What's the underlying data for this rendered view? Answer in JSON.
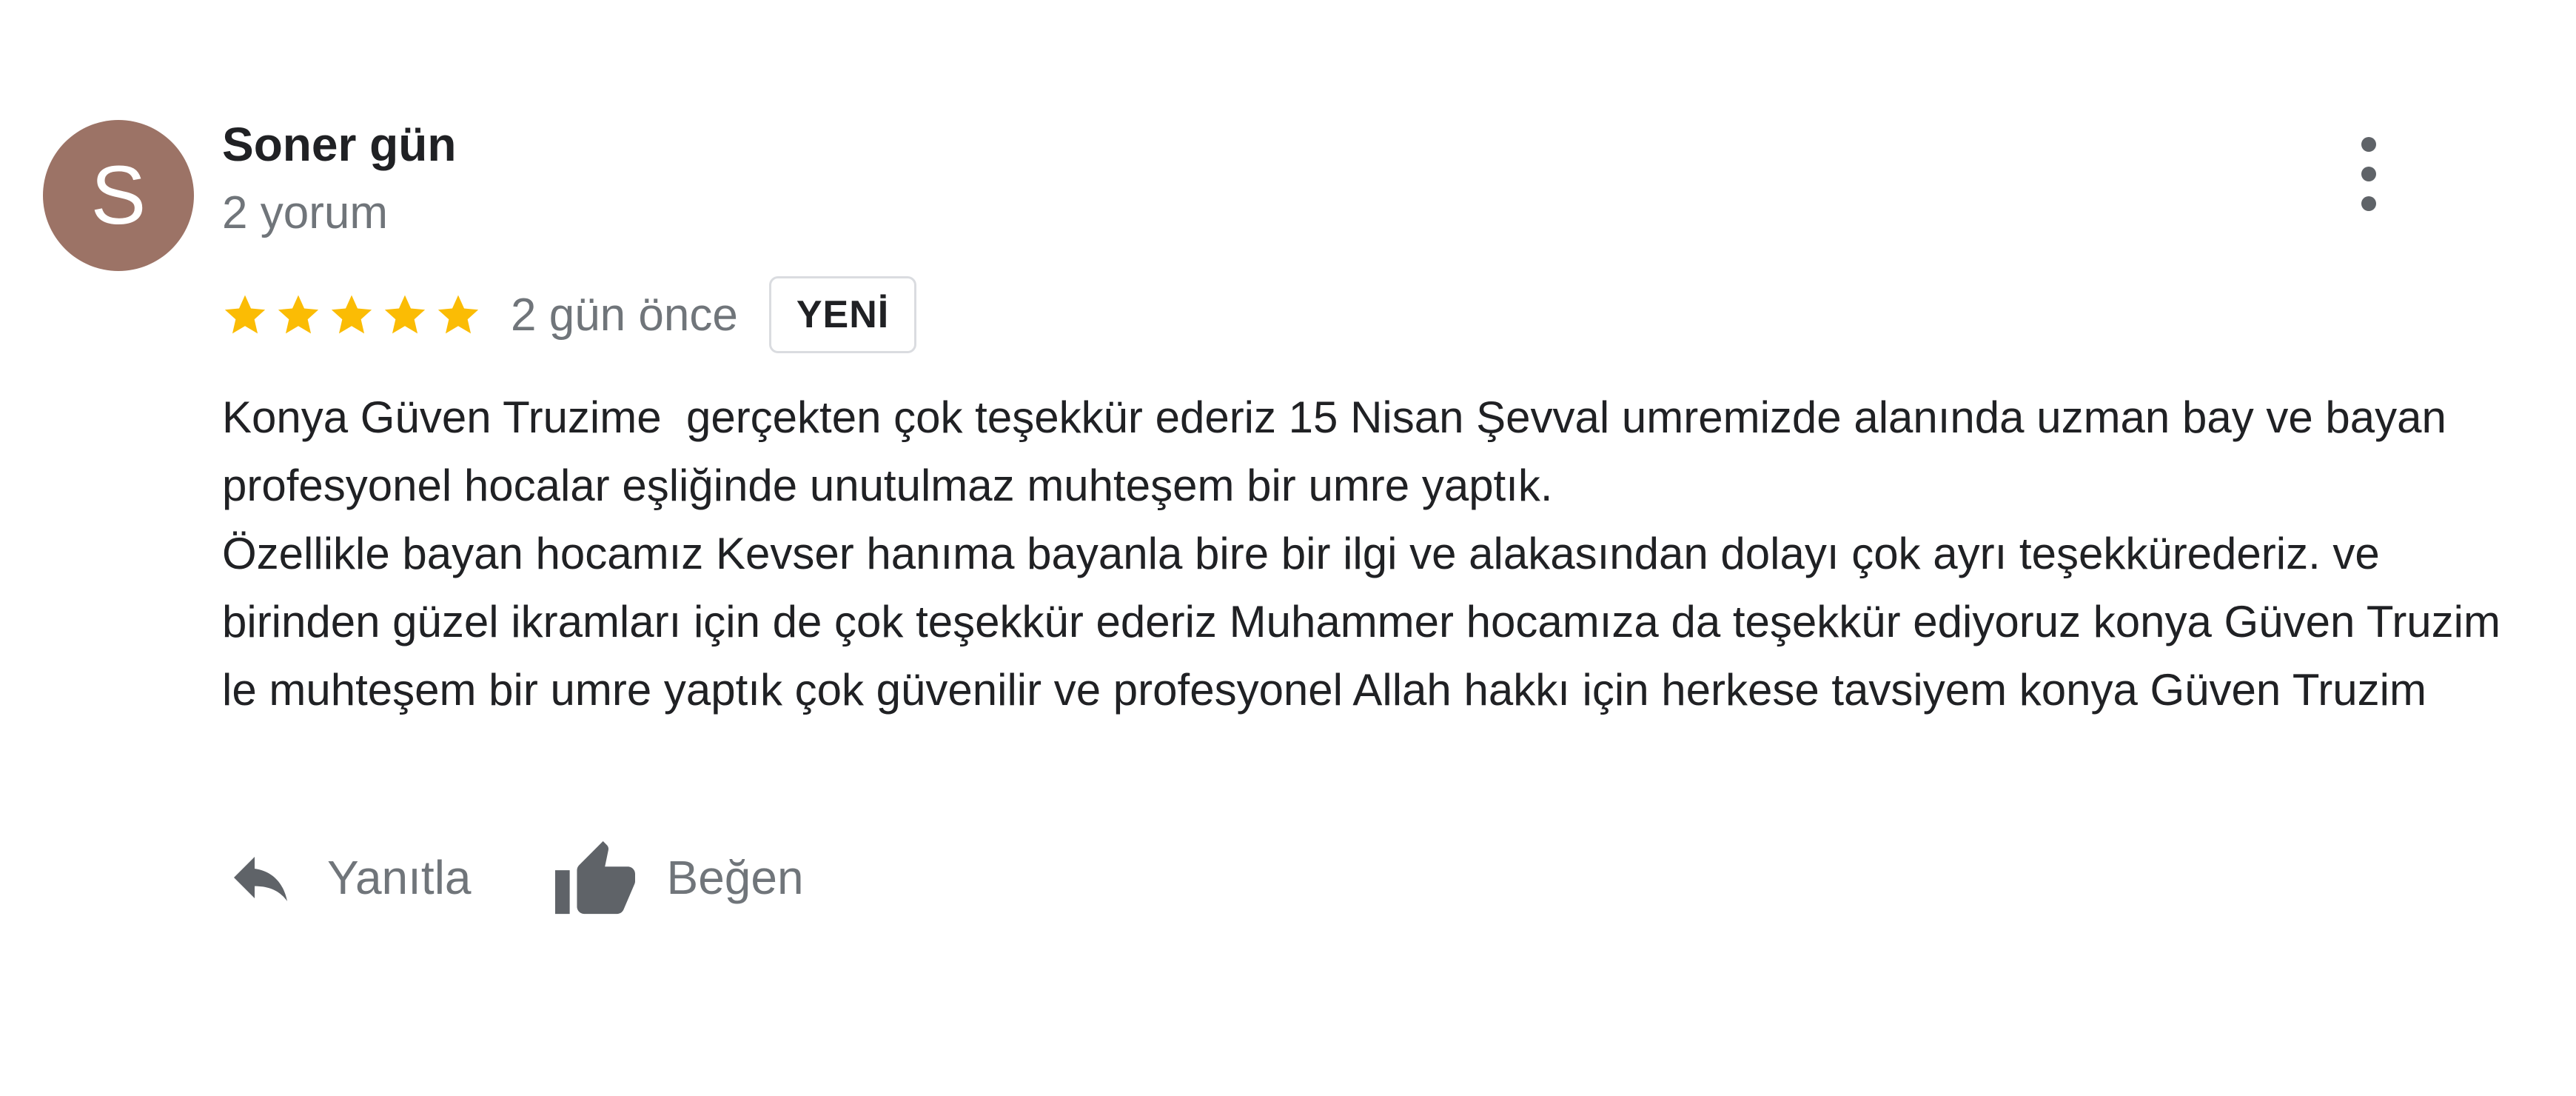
{
  "review": {
    "author": {
      "avatar_letter": "S",
      "avatar_color": "#9c7366",
      "name": "Soner gün",
      "meta": "2 yorum"
    },
    "more_icon": "more-vert-icon",
    "rating": {
      "stars": 5,
      "max_stars": 5,
      "star_color": "#fbbc04",
      "star_icon": "star-icon"
    },
    "date": "2 gün önce",
    "badge": "YENİ",
    "text": {
      "paragraph_1": "Konya Güven Truzime  gerçekten çok teşekkür ederiz 15 Nisan Şevval umremizde alanında uzman bay ve bayan profesyonel hocalar eşliğinde unutulmaz muhteşem bir umre yaptık.",
      "paragraph_2": "Özellikle bayan hocamız Kevser hanıma bayanla bire bir ilgi ve alakasından dolayı çok ayrı teşekkürederiz. ve birinden güzel ikramları için de çok teşekkür ederiz Muhammer hocamıza da teşekkür ediyoruz konya Güven Truzim le muhteşem bir umre yaptık çok güvenilir ve profesyonel Allah hakkı için herkese tavsiyem konya Güven Truzim"
    },
    "actions": {
      "reply": {
        "label": "Yanıtla",
        "icon": "reply-icon"
      },
      "like": {
        "label": "Beğen",
        "icon": "thumb-up-icon"
      }
    }
  }
}
